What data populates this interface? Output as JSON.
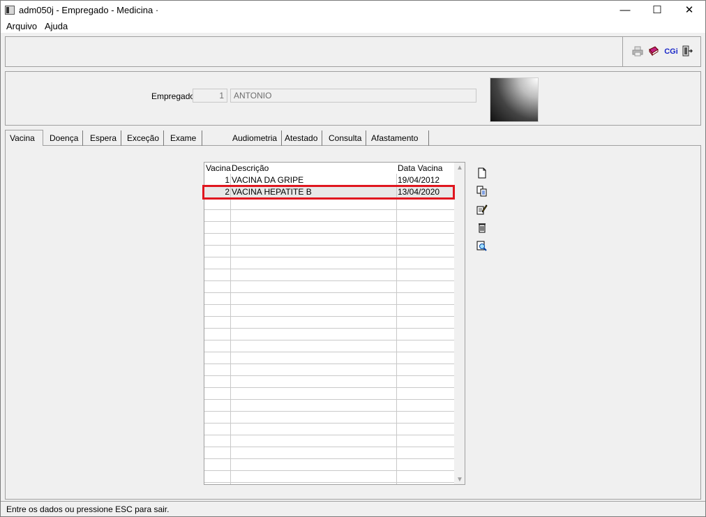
{
  "window": {
    "title": "adm050j - Empregado - Medicina ·",
    "minimize": "—",
    "maximize": "☐",
    "close": "✕"
  },
  "menu": [
    "Arquivo",
    "Ajuda"
  ],
  "toolbar": {
    "icons": [
      "printer-icon",
      "book-icon",
      "cgi-icon",
      "exit-icon"
    ],
    "cgi_label": "CGi"
  },
  "employee": {
    "label": "Empregado:",
    "code": "1",
    "name": "ANTONIO"
  },
  "tabs": [
    "Vacina",
    "Doença",
    "Espera",
    "Exceção",
    "Exame Médico",
    "Audiometria",
    "Atestado",
    "Consulta",
    "Afastamento Previdenciário"
  ],
  "active_tab": "Vacina",
  "grid": {
    "columns": [
      "Vacina",
      "Descrição",
      "Data Vacina"
    ],
    "rows": [
      {
        "vacina": "1",
        "descricao": "VACINA DA GRIPE",
        "data": "19/04/2012"
      },
      {
        "vacina": "2",
        "descricao": "VACINA HEPATITE B",
        "data": "13/04/2020"
      }
    ],
    "selected_row": 2
  },
  "actions": [
    "new-icon",
    "copy-icon",
    "edit-icon",
    "delete-icon",
    "search-icon"
  ],
  "status": "Entre os dados ou pressione ESC para sair.",
  "colors": {
    "highlight": "#e0161f",
    "grid_line": "#c9c9c9",
    "panel_bg": "#f0f0f0"
  }
}
